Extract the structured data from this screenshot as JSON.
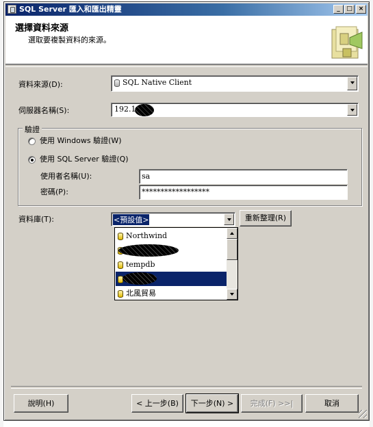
{
  "window": {
    "title": "SQL Server 匯入和匯出精靈",
    "min_glyph": "_",
    "max_glyph": "□",
    "close_glyph": "×"
  },
  "header": {
    "title": "選擇資料來源",
    "subtitle": "選取要複製資料的來源。"
  },
  "form": {
    "source_label": "資料來源(D):",
    "source_value": "SQL Native Client",
    "server_label": "伺服器名稱(S):",
    "server_value": "192.1.",
    "auth_group_label": "驗證",
    "windows_auth_label": "使用 Windows 驗證(W)",
    "sql_auth_label": "使用 SQL Server 驗證(Q)",
    "auth_selected": "sql",
    "username_label": "使用者名稱(U):",
    "username_value": "sa",
    "password_label": "密碼(P):",
    "password_value": "******************",
    "database_label": "資料庫(T):",
    "database_value": "<預設值>",
    "refresh_button": "重新整理(R)"
  },
  "database_dropdown": {
    "items": [
      {
        "label": "Northwind"
      },
      {
        "label": ""
      },
      {
        "label": "tempdb"
      },
      {
        "label": ""
      },
      {
        "label": "北風貿易"
      }
    ],
    "selected_index": 3
  },
  "buttons": {
    "help": "說明(H)",
    "back": "< 上一步(B)",
    "next": "下一步(N) >",
    "finish": "完成(F) >>|",
    "cancel": "取消"
  },
  "colors": {
    "dialog_bg": "#d4d0c8",
    "selection": "#0a246a",
    "title_gradient_start": "#0a246a",
    "title_gradient_end": "#a6caf0"
  }
}
